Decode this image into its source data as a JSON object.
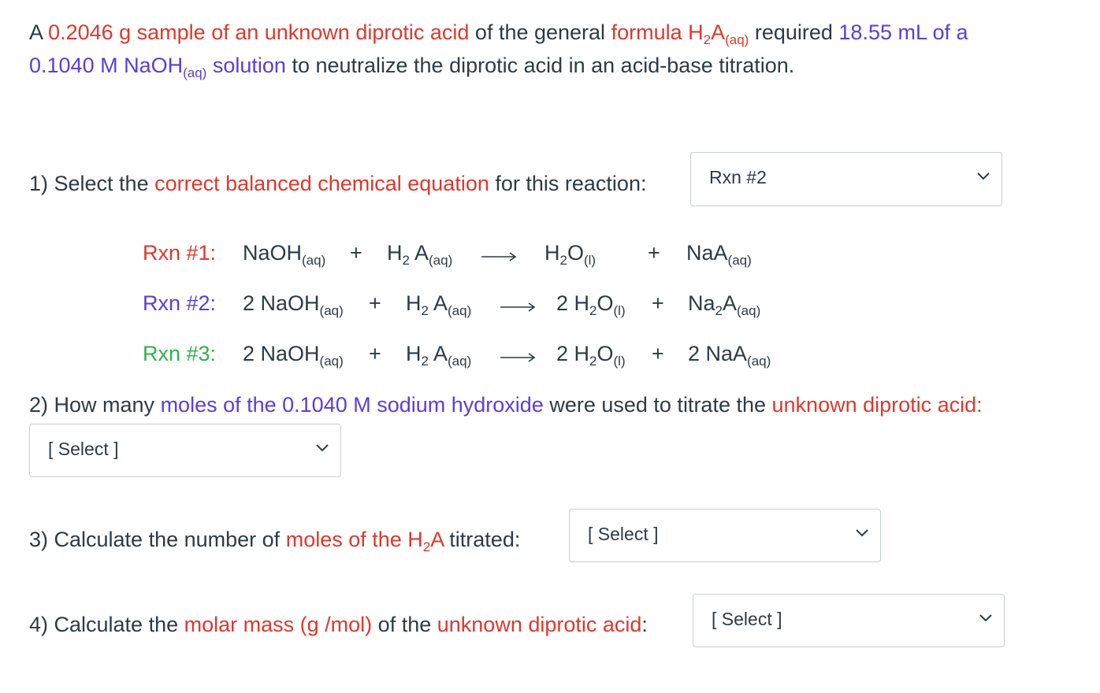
{
  "problem": {
    "p1_a": "A",
    "p1_sample": "0.2046 g sample of an unknown diprotic acid",
    "p1_b": "of the general",
    "p1_formula_word": "formula H",
    "p1_formula_sub2": "2",
    "p1_formula_A": "A",
    "p1_formula_aq": "(aq)",
    "p1_c": "required",
    "p1_volume": "18.55 mL of a",
    "p2_naoh": "0.1040 M NaOH",
    "p2_aq": "(aq)",
    "p2_solution": "solution",
    "p2_rest": "to neutralize the diprotic acid in an acid-base titration."
  },
  "q1": {
    "prefix": "1) Select the",
    "highlight": "correct balanced chemical equation",
    "suffix": "for this reaction:",
    "selected": "Rxn #2"
  },
  "reactions": [
    {
      "label": "Rxn #1:",
      "reactant1_coef": "",
      "reactant1": "NaOH",
      "reactant1_state": "(aq)",
      "plus1": "+",
      "reactant2": "H",
      "reactant2_sub": "2",
      "reactant2_b": " A",
      "reactant2_state": "(aq)",
      "product1": "H",
      "product1_sub": "2",
      "product1_b": "O",
      "product1_state": "(l)",
      "plus2": "+",
      "product2": "NaA",
      "product2_sub": "",
      "product2_b": "",
      "product2_state": "(aq)"
    },
    {
      "label": "Rxn #2:",
      "reactant1": "2 NaOH",
      "reactant1_state": "(aq)",
      "plus1": "+",
      "reactant2": "H",
      "reactant2_sub": "2",
      "reactant2_b": " A",
      "reactant2_state": "(aq)",
      "product1": "2 H",
      "product1_sub": "2",
      "product1_b": "O",
      "product1_state": "(l)",
      "plus2": "+",
      "product2": "Na",
      "product2_sub": "2",
      "product2_b": "A",
      "product2_state": "(aq)"
    },
    {
      "label": "Rxn #3:",
      "reactant1": "2 NaOH",
      "reactant1_state": "(aq)",
      "plus1": "+",
      "reactant2": "H",
      "reactant2_sub": "2",
      "reactant2_b": " A",
      "reactant2_state": "(aq)",
      "product1": "2 H",
      "product1_sub": "2",
      "product1_b": "O",
      "product1_state": "(l)",
      "plus2": "+",
      "product2": "2 NaA",
      "product2_sub": "",
      "product2_b": "",
      "product2_state": "(aq)"
    }
  ],
  "q2": {
    "prefix": "2) How many",
    "highlight": "moles of the 0.1040 M sodium hydroxide",
    "middle": "were used to titrate the",
    "highlight2": "unknown diprotic acid:",
    "selected": "[ Select ]"
  },
  "q3": {
    "prefix": "3) Calculate the number of",
    "highlight": "moles of the H",
    "highlight_sub": "2",
    "highlight_b": "A",
    "suffix": "titrated:",
    "selected": "[ Select ]"
  },
  "q4": {
    "prefix": "4) Calculate the",
    "highlight": "molar mass (g /mol)",
    "middle": "of the",
    "highlight2": "unknown diprotic acid",
    "colon": ":",
    "selected": "[ Select ]"
  },
  "colors": {
    "red": "#e0372c",
    "blue": "#5a3ddc",
    "green": "#2fb24a",
    "text": "#2d3b45"
  },
  "icons": {
    "dropdown": "chevron-down-icon",
    "arrow": "reaction-arrow-icon"
  }
}
